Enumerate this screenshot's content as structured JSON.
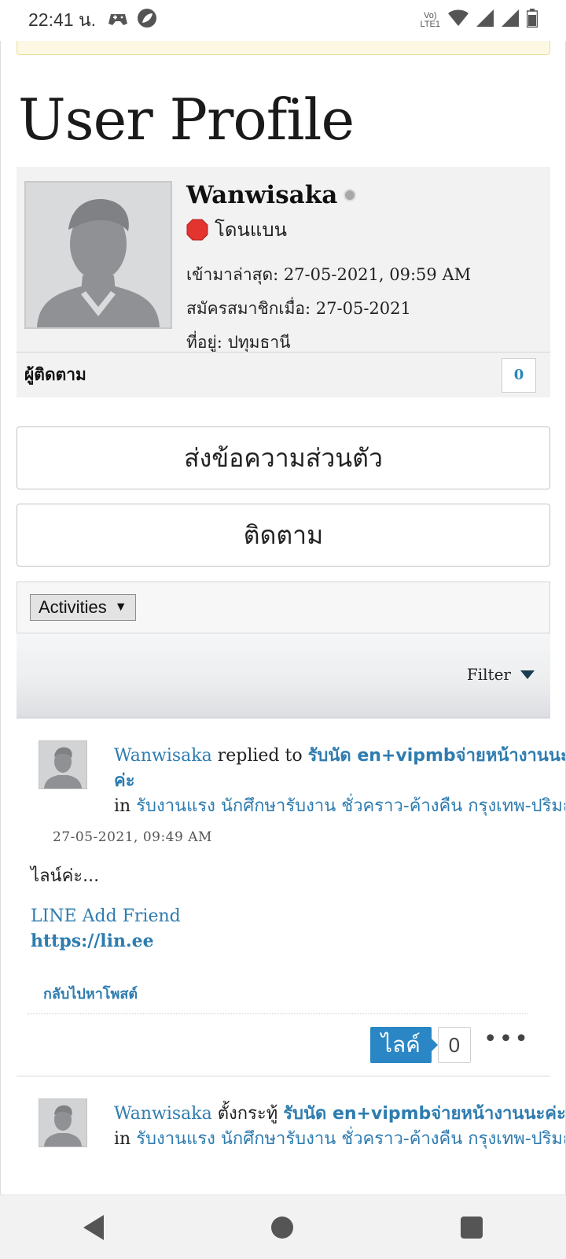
{
  "status_bar": {
    "time": "22:41 น.",
    "network_label": "LTE1"
  },
  "page": {
    "title": "User Profile"
  },
  "profile": {
    "username": "Wanwisaka",
    "status": "โดนแบน",
    "last_visit": "เข้ามาล่าสุด: 27-05-2021, 09:59 AM",
    "joined": "สมัครสมาชิกเมื่อ: 27-05-2021",
    "location": "ที่อยู่: ปทุมธานี",
    "followers_label": "ผู้ติดตาม",
    "followers_count": "0"
  },
  "actions": {
    "private_message": "ส่งข้อความส่วนตัว",
    "follow": "ติดตาม"
  },
  "activities": {
    "selected": "Activities",
    "filter_label": "Filter"
  },
  "activity_items": [
    {
      "user": "Wanwisaka",
      "verb": "replied to",
      "topic": "รับนัด en+vipmbจ่ายหน้างานนะค่ะ",
      "in_label": "in",
      "forum": "รับงานแรง นักศึกษารับงาน ชั่วคราว-ค้างคืน กรุงเทพ-ปริมณฑล",
      "time": "27-05-2021, 09:49 AM",
      "body": "ไลน์ค่ะ...",
      "line_text": "LINE Add Friend",
      "url": "https://lin.ee",
      "back_link": "กลับไปหาโพสต์",
      "like_label": "ไลค์",
      "like_count": "0",
      "more": "•••"
    },
    {
      "user": "Wanwisaka",
      "verb": "ตั้งกระทู้",
      "topic": "รับนัด en+vipmbจ่ายหน้างานนะค่ะ",
      "in_label": "in",
      "forum": "รับงานแรง นักศึกษารับงาน ชั่วคราว-ค้างคืน กรุงเทพ-ปริมณฑล"
    }
  ],
  "colors": {
    "link": "#2e7cb0",
    "like_button": "#2a86c4",
    "card_bg": "#f2f2f2"
  },
  "icons": {
    "status_left": [
      "game-controller-icon",
      "leaf-app-icon"
    ],
    "status_right": [
      "volte-icon",
      "wifi-icon",
      "signal-icon",
      "signal-icon",
      "battery-icon"
    ],
    "nav": [
      "back-icon",
      "home-icon",
      "recents-icon"
    ]
  }
}
